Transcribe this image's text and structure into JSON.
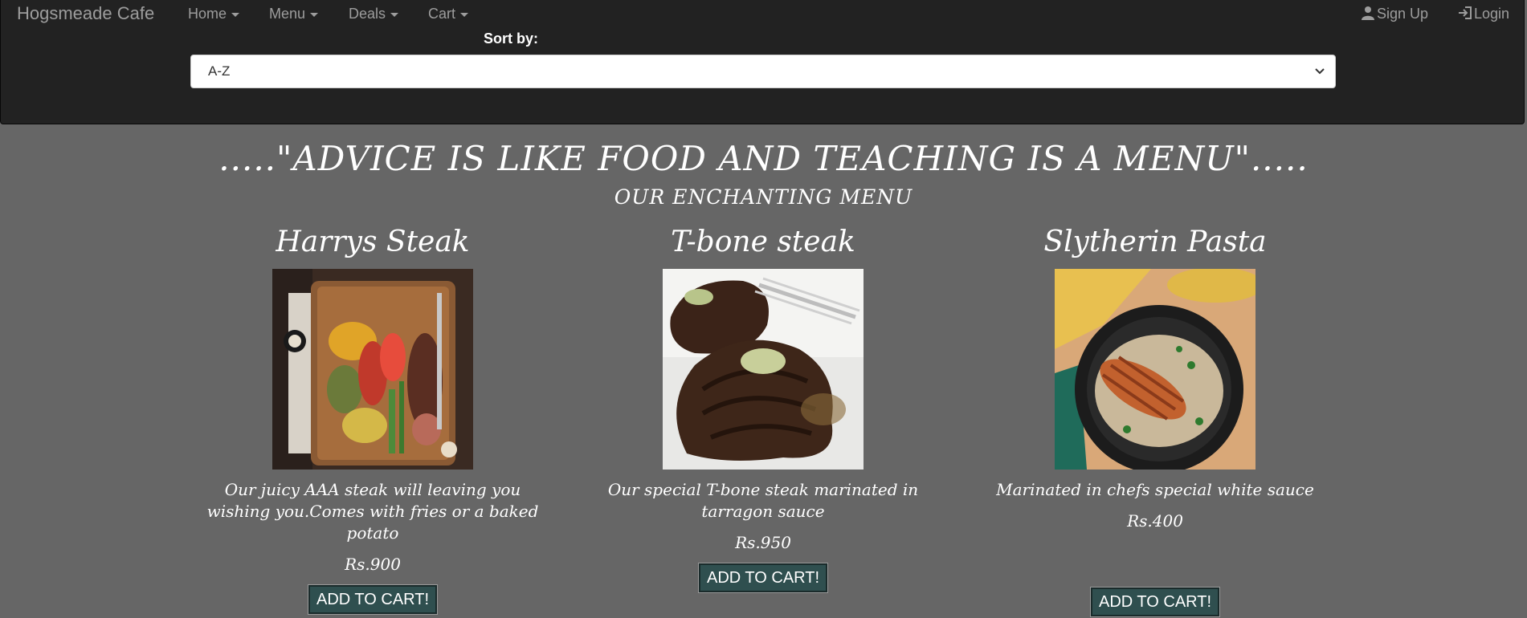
{
  "navbar": {
    "brand": "Hogsmeade Cafe",
    "menu": [
      {
        "label": "Home"
      },
      {
        "label": "Menu"
      },
      {
        "label": "Deals"
      },
      {
        "label": "Cart"
      }
    ],
    "signup_label": "Sign Up",
    "login_label": "Login"
  },
  "sort": {
    "label": "Sort by:",
    "selected": "A-Z"
  },
  "quote": ".....\"ADVICE IS LIKE FOOD AND TEACHING IS A MENU\".....",
  "subtitle": "OUR ENCHANTING MENU",
  "products": [
    {
      "name": "Harrys Steak",
      "description": "Our juicy AAA steak will leaving you wishing you.Comes with fries or a baked potato",
      "price": "Rs.900",
      "button": "ADD TO CART!"
    },
    {
      "name": "T-bone steak",
      "description": "Our special T-bone steak marinated in tarragon sauce",
      "price": "Rs.950",
      "button": "ADD TO CART!"
    },
    {
      "name": "Slytherin Pasta",
      "description": "Marinated in chefs special white sauce",
      "price": "Rs.400",
      "button": "ADD TO CART!"
    }
  ]
}
